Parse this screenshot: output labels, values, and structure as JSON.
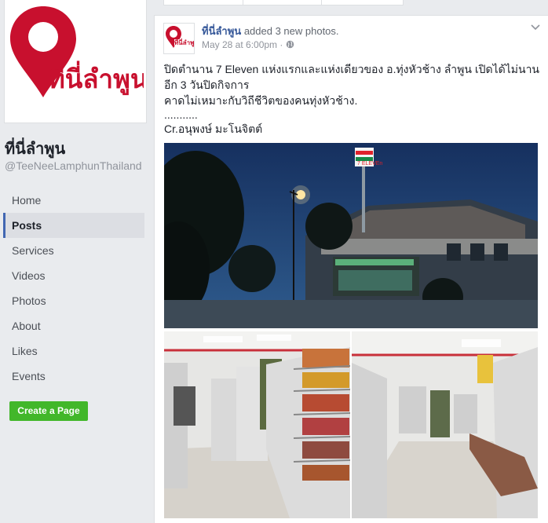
{
  "page": {
    "name": "ที่นี่ลำพูน",
    "handle": "@TeeNeeLamphunThailand",
    "logo_text": "ที่นี่ลำพูน"
  },
  "nav": {
    "items": [
      "Home",
      "Posts",
      "Services",
      "Videos",
      "Photos",
      "About",
      "Likes",
      "Events"
    ],
    "active": "Posts"
  },
  "create_page_label": "Create a Page",
  "post": {
    "author": "ที่นี่ลำพูน",
    "action": "added 3 new photos.",
    "time": "May 28 at 6:00pm",
    "dot": "·",
    "text_lines": [
      "ปิดตำนาน 7 Eleven แห่งแรกและแห่งเดียวของ อ.ทุ่งหัวช้าง ลำพูน เปิดได้ไม่นาน",
      "อีก 3 วันปิดกิจการ",
      "คาดไม่เหมาะกับวิถีชีวิตของคนทุ่งหัวช้าง.",
      "...........",
      "Cr.อนุพงษ์ มะโนจิตต์"
    ],
    "sign_text": "7 ELEVEn"
  },
  "colors": {
    "brand_red": "#c8102e",
    "link_blue": "#365899",
    "active_bar": "#4267b2",
    "create_green": "#42b72a"
  },
  "icons": {
    "privacy": "globe-icon",
    "menu": "chevron-down-icon",
    "logo": "location-pin-icon"
  }
}
